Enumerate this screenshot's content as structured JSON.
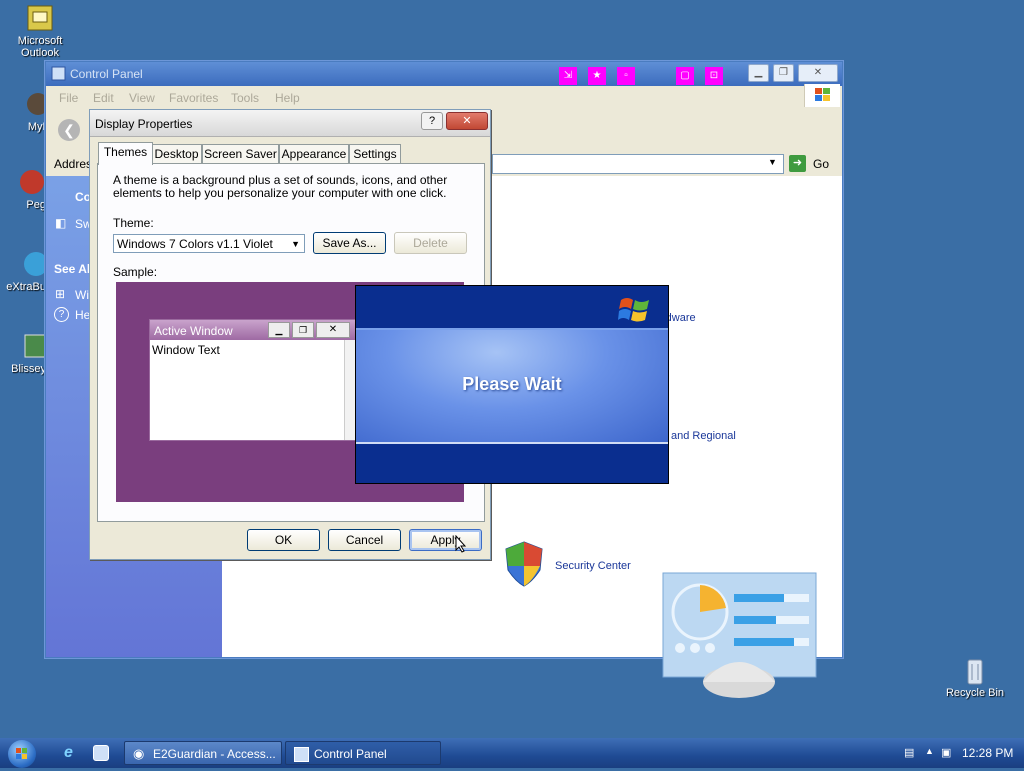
{
  "desktop": {
    "icons": [
      {
        "label": "Microsoft Outlook"
      },
      {
        "label": "MyPa"
      },
      {
        "label": "Peg"
      },
      {
        "label": "eXtraBu"
      },
      {
        "label": "Blissey"
      },
      {
        "label": "Recycle Bin"
      }
    ]
  },
  "control_panel": {
    "title": "Control Panel",
    "menu": [
      "File",
      "Edit",
      "View",
      "Favorites",
      "Tools",
      "Help"
    ],
    "address_label": "Addres",
    "go_label": "Go",
    "left_pane": {
      "item1": "Co",
      "item2": "Sw",
      "see_also": "See Als",
      "item3": "Wi",
      "item4": "He"
    },
    "categories": {
      "printers": "Printers and Other Hardware",
      "regional": "and Regional",
      "security": "Security Center"
    }
  },
  "display_properties": {
    "title": "Display Properties",
    "help_glyph": "?",
    "close_glyph": "✕",
    "tabs": [
      "Themes",
      "Desktop",
      "Screen Saver",
      "Appearance",
      "Settings"
    ],
    "active_tab": "Themes",
    "description": "A theme is a background plus a set of sounds, icons, and other elements to help you personalize your computer with one click.",
    "theme_label": "Theme:",
    "theme_value": "Windows 7 Colors v1.1 Violet",
    "save_as": "Save As...",
    "delete": "Delete",
    "sample_label": "Sample:",
    "sample_window_title": "Active Window",
    "sample_window_text": "Window Text",
    "ok": "OK",
    "cancel": "Cancel",
    "apply": "Apply"
  },
  "please_wait": {
    "message": "Please Wait"
  },
  "taskbar": {
    "buttons": [
      "E2Guardian - Access...",
      "Control Panel"
    ],
    "clock": "12:28 PM"
  },
  "colors": {
    "desktop": "#3a6ea5",
    "sample_bg": "#7a3e7e",
    "please_wait_dark": "#0a2e8f",
    "magenta_buttons": "#ff00ff"
  }
}
